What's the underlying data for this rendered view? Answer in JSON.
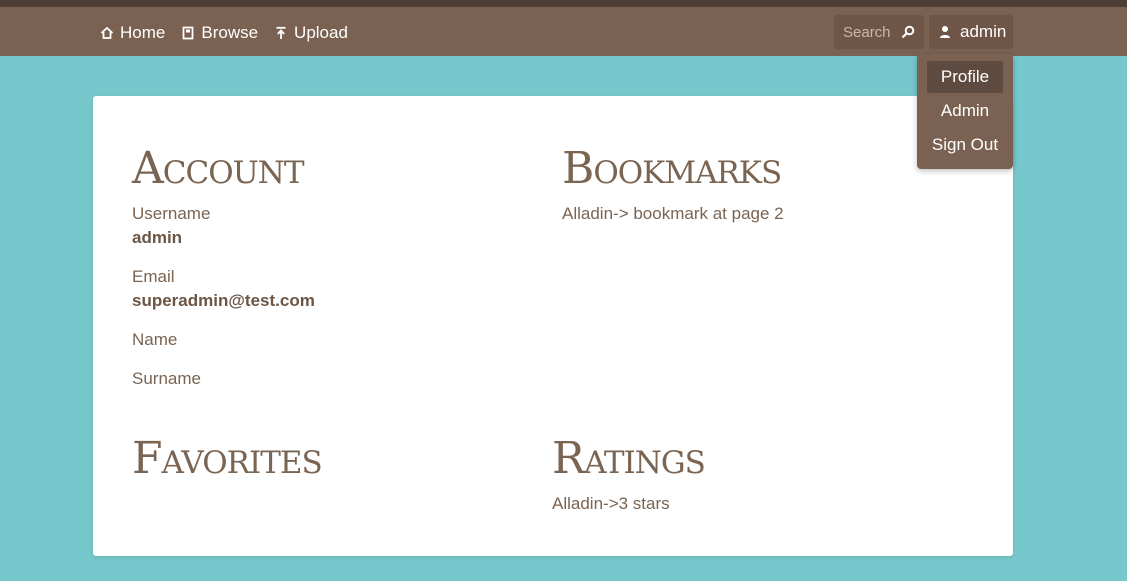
{
  "nav": {
    "home_label": "Home",
    "browse_label": "Browse",
    "upload_label": "Upload",
    "search_placeholder": "Search",
    "user_label": "admin"
  },
  "user_menu": {
    "items": [
      "Profile",
      "Admin",
      "Sign Out"
    ],
    "active_index": 0
  },
  "account": {
    "title": "Account",
    "username_label": "Username",
    "username_value": "admin",
    "email_label": "Email",
    "email_value": "superadmin@test.com",
    "name_label": "Name",
    "surname_label": "Surname"
  },
  "bookmarks": {
    "title": "Bookmarks",
    "items": [
      "Alladin-> bookmark at page 2"
    ]
  },
  "favorites": {
    "title": "Favorites"
  },
  "ratings": {
    "title": "Ratings",
    "items": [
      "Alladin->3 stars"
    ]
  },
  "icons": {
    "home": "home-icon",
    "browse": "book-icon",
    "upload": "upload-icon",
    "search": "search-icon",
    "user": "user-icon"
  },
  "colors": {
    "background": "#76c8cc",
    "navbar": "#7b6151",
    "navbar_top_border": "#4d3f37",
    "card": "#ffffff",
    "text_brown": "#7a6452",
    "active_menu_item": "#5e4a3e"
  }
}
